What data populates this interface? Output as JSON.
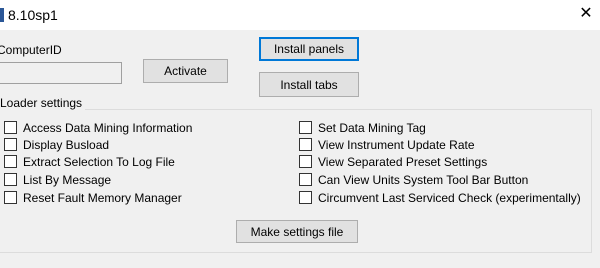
{
  "window": {
    "title": "8.10sp1",
    "close_glyph": "✕"
  },
  "computer_id": {
    "label": "ComputerID",
    "value": ""
  },
  "buttons": {
    "activate": "Activate",
    "install_panels": "Install panels",
    "install_tabs": "Install tabs",
    "make_settings_file": "Make settings file"
  },
  "loader_settings": {
    "title": "Loader settings",
    "left": [
      {
        "label": "Access Data Mining Information",
        "checked": false
      },
      {
        "label": "Display Busload",
        "checked": false
      },
      {
        "label": "Extract Selection To Log File",
        "checked": false
      },
      {
        "label": "List By Message",
        "checked": false
      },
      {
        "label": "Reset Fault Memory Manager",
        "checked": false
      }
    ],
    "right": [
      {
        "label": "Set Data Mining Tag",
        "checked": false
      },
      {
        "label": "View Instrument Update Rate",
        "checked": false
      },
      {
        "label": "View Separated Preset Settings",
        "checked": false
      },
      {
        "label": "Can View Units System Tool Bar Button",
        "checked": false
      },
      {
        "label": "Circumvent Last Serviced Check (experimentally)",
        "checked": false
      }
    ]
  },
  "colors": {
    "focus_border": "#0078d7",
    "window_bg": "#f0f0f0"
  }
}
